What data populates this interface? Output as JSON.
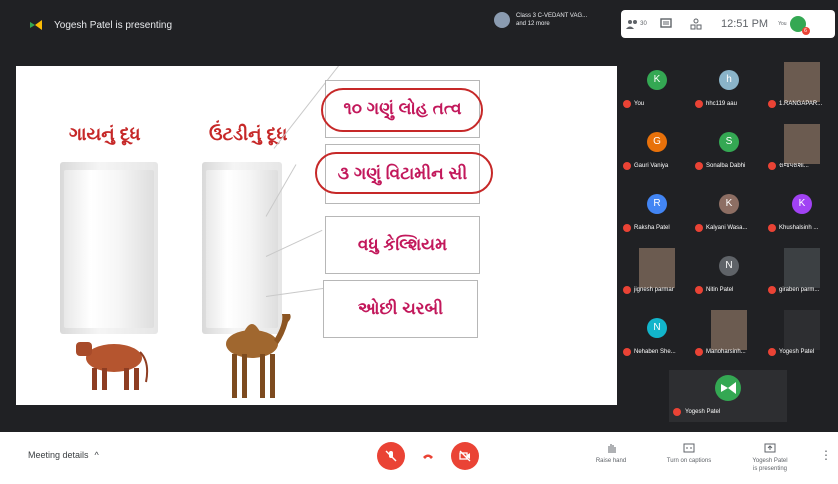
{
  "topbar": {
    "presenting_label": "Yogesh Patel is presenting",
    "class_name_line1": "Class 3 C-VEDANT VAG...",
    "class_name_line2": "and 12 more",
    "participants_count": "30",
    "time": "12:51 PM",
    "you_label": "You",
    "notification_count": "6"
  },
  "slide": {
    "heading_left": "ગાયનું દૂધ",
    "heading_right": "ઉંટડીનું દૂધ",
    "boxes": [
      "૧૦ ગણું લોહ તત્વ",
      "૩ ગણું વિટામીન સી",
      "વધુ કેલ્શિયમ",
      "ઓછી ચરબી"
    ]
  },
  "participants": [
    {
      "initial": "K",
      "name": "You",
      "color": "#34a853"
    },
    {
      "initial": "h",
      "name": "hhc119 aau",
      "color": "#8ab4c9"
    },
    {
      "initial": "",
      "name": "1.RANGAPAR...",
      "color": "#6b5b50"
    },
    {
      "initial": "G",
      "name": "Gauri Vaniya",
      "color": "#e8710a"
    },
    {
      "initial": "S",
      "name": "Sonalba Dabhi",
      "color": "#34a853"
    },
    {
      "initial": "",
      "name": "રાજપરાશા...",
      "color": "#6b5b50"
    },
    {
      "initial": "R",
      "name": "Raksha Patel",
      "color": "#4285f4"
    },
    {
      "initial": "K",
      "name": "Kalyani Wasa...",
      "color": "#8d6e63"
    },
    {
      "initial": "K",
      "name": "Khushalsinh ...",
      "color": "#a142f4"
    },
    {
      "initial": "",
      "name": "jignesh parmar",
      "color": "#6b5b50"
    },
    {
      "initial": "N",
      "name": "Nitin Patel",
      "color": "#5f6368"
    },
    {
      "initial": "",
      "name": "giraben parm...",
      "color": "#3c4043"
    },
    {
      "initial": "N",
      "name": "Nehaben She...",
      "color": "#12b5cb"
    },
    {
      "initial": "",
      "name": "Manoharsinh...",
      "color": "#6b5b50"
    },
    {
      "initial": "",
      "name": "Yogesh Patel",
      "color": "#2d2e31"
    }
  ],
  "self_tile_name": "Yogesh Patel",
  "bottombar": {
    "meeting_details": "Meeting details",
    "raise_hand": "Raise hand",
    "captions": "Turn on captions",
    "presenting_line1": "Yogesh Patel",
    "presenting_line2": "is presenting"
  },
  "colors": {
    "accent_red": "#ea4335",
    "meet_green": "#34a853"
  }
}
